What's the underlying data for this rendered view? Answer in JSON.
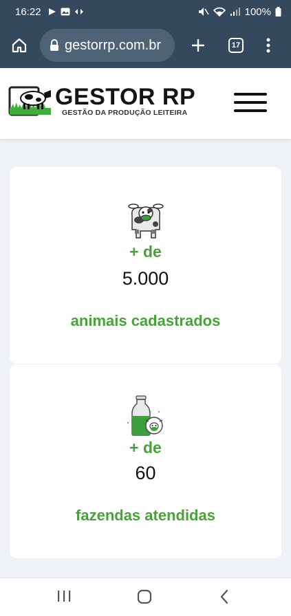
{
  "status_bar": {
    "time": "16:22",
    "battery": "100%"
  },
  "browser": {
    "url": "gestorrp.com.br",
    "tab_count": "17"
  },
  "site": {
    "logo_title": "GESTOR RP",
    "logo_subtitle": "GESTÃO DA PRODUÇÃO LEITEIRA"
  },
  "stats": [
    {
      "prefix": "+ de",
      "value": "5.000",
      "label": "animais cadastrados",
      "icon": "cow-icon"
    },
    {
      "prefix": "+ de",
      "value": "60",
      "label": "fazendas atendidas",
      "icon": "milk-bottle-icon"
    }
  ],
  "colors": {
    "toolbar": "#34495e",
    "accent_green": "#4aa13b",
    "page_bg": "#eef1f5"
  }
}
